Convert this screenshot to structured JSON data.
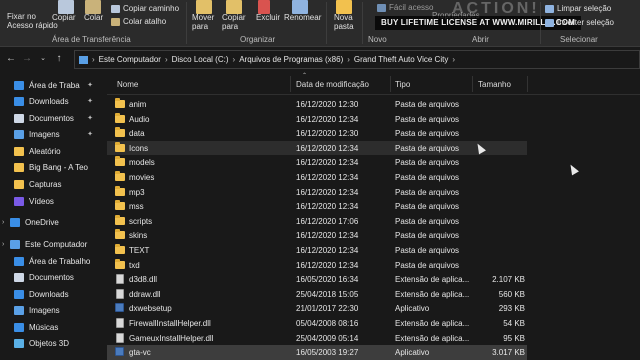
{
  "ribbon": {
    "clipboard": {
      "pin_label": "Fixar no",
      "pin_label2": "Acesso rápido",
      "copy_label": "Copiar",
      "paste_label": "Colar",
      "copy_path_label": "Copiar caminho",
      "paste_shortcut_label": "Colar atalho",
      "group_label": "Área de Transferência"
    },
    "organize": {
      "move_label": "Mover",
      "move_label2": "para",
      "copy_to_label": "Copiar",
      "copy_to_label2": "para",
      "delete_label": "Excluir",
      "rename_label": "Renomear",
      "group_label": "Organizar"
    },
    "new": {
      "new_folder_label": "Nova",
      "new_folder_label2": "pasta",
      "group_label": "Novo"
    },
    "open": {
      "easy_access_label": "Fácil acesso",
      "properties_label": "Propriedades",
      "group_label": "Abrir"
    },
    "select": {
      "clear_selection_label": "Limpar seleção",
      "invert_selection_label": "Inverter seleção",
      "group_label": "Selecionar"
    },
    "watermark_text": "BUY LIFETIME LICENSE AT WWW.MIRILLIS.COM",
    "watermark_logo": "ACTION!"
  },
  "address": {
    "crumbs": [
      "Este Computador",
      "Disco Local (C:)",
      "Arquivos de Programas (x86)",
      "Grand Theft Auto Vice City"
    ]
  },
  "navpane": {
    "items": [
      {
        "label": "Área de Traba",
        "icon": "desktop-icon",
        "color": "#3a8ee6",
        "pinned": true
      },
      {
        "label": "Downloads",
        "icon": "download-icon",
        "color": "#3a8ee6",
        "pinned": true
      },
      {
        "label": "Documentos",
        "icon": "document-icon",
        "color": "#cfd8e6",
        "pinned": true
      },
      {
        "label": "Imagens",
        "icon": "image-icon",
        "color": "#5aa0e6",
        "pinned": true
      },
      {
        "label": "Aleatório",
        "icon": "folder-icon",
        "color": "#f2c14e",
        "pinned": false
      },
      {
        "label": "Big Bang - A Teo",
        "icon": "folder-icon",
        "color": "#f2c14e",
        "pinned": false
      },
      {
        "label": "Capturas",
        "icon": "folder-icon",
        "color": "#f2c14e",
        "pinned": false
      },
      {
        "label": "Vídeos",
        "icon": "video-icon",
        "color": "#7a5ae6",
        "pinned": false
      },
      {
        "label": "OneDrive",
        "icon": "cloud-icon",
        "color": "#3a8ee6",
        "pinned": false
      },
      {
        "label": "Este Computador",
        "icon": "computer-icon",
        "color": "#5aa0e6",
        "pinned": false
      },
      {
        "label": "Área de Trabalho",
        "icon": "desktop-icon",
        "color": "#3a8ee6",
        "pinned": false
      },
      {
        "label": "Documentos",
        "icon": "document-icon",
        "color": "#cfd8e6",
        "pinned": false
      },
      {
        "label": "Downloads",
        "icon": "download-icon",
        "color": "#3a8ee6",
        "pinned": false
      },
      {
        "label": "Imagens",
        "icon": "image-icon",
        "color": "#5aa0e6",
        "pinned": false
      },
      {
        "label": "Músicas",
        "icon": "music-icon",
        "color": "#3a8ee6",
        "pinned": false
      },
      {
        "label": "Objetos 3D",
        "icon": "cube-icon",
        "color": "#5ab0e6",
        "pinned": false
      }
    ]
  },
  "columns": {
    "name": "Nome",
    "date": "Data de modificação",
    "type": "Tipo",
    "size": "Tamanho"
  },
  "files": [
    {
      "name": "anim",
      "date": "16/12/2020 12:30",
      "type": "Pasta de arquivos",
      "size": "",
      "kind": "folder"
    },
    {
      "name": "Audio",
      "date": "16/12/2020 12:34",
      "type": "Pasta de arquivos",
      "size": "",
      "kind": "folder"
    },
    {
      "name": "data",
      "date": "16/12/2020 12:30",
      "type": "Pasta de arquivos",
      "size": "",
      "kind": "folder"
    },
    {
      "name": "Icons",
      "date": "16/12/2020 12:34",
      "type": "Pasta de arquivos",
      "size": "",
      "kind": "folder"
    },
    {
      "name": "models",
      "date": "16/12/2020 12:34",
      "type": "Pasta de arquivos",
      "size": "",
      "kind": "folder"
    },
    {
      "name": "movies",
      "date": "16/12/2020 12:34",
      "type": "Pasta de arquivos",
      "size": "",
      "kind": "folder"
    },
    {
      "name": "mp3",
      "date": "16/12/2020 12:34",
      "type": "Pasta de arquivos",
      "size": "",
      "kind": "folder"
    },
    {
      "name": "mss",
      "date": "16/12/2020 12:34",
      "type": "Pasta de arquivos",
      "size": "",
      "kind": "folder"
    },
    {
      "name": "scripts",
      "date": "16/12/2020 17:06",
      "type": "Pasta de arquivos",
      "size": "",
      "kind": "folder"
    },
    {
      "name": "skins",
      "date": "16/12/2020 12:34",
      "type": "Pasta de arquivos",
      "size": "",
      "kind": "folder"
    },
    {
      "name": "TEXT",
      "date": "16/12/2020 12:34",
      "type": "Pasta de arquivos",
      "size": "",
      "kind": "folder"
    },
    {
      "name": "txd",
      "date": "16/12/2020 12:34",
      "type": "Pasta de arquivos",
      "size": "",
      "kind": "folder"
    },
    {
      "name": "d3d8.dll",
      "date": "16/05/2020 16:34",
      "type": "Extensão de aplica...",
      "size": "2.107 KB",
      "kind": "dll"
    },
    {
      "name": "ddraw.dll",
      "date": "25/04/2018 15:05",
      "type": "Extensão de aplica...",
      "size": "560 KB",
      "kind": "dll"
    },
    {
      "name": "dxwebsetup",
      "date": "21/01/2017 22:30",
      "type": "Aplicativo",
      "size": "293 KB",
      "kind": "exe"
    },
    {
      "name": "FirewallInstallHelper.dll",
      "date": "05/04/2008 08:16",
      "type": "Extensão de aplica...",
      "size": "54 KB",
      "kind": "dll"
    },
    {
      "name": "GameuxInstallHelper.dll",
      "date": "25/04/2009 05:14",
      "type": "Extensão de aplica...",
      "size": "95 KB",
      "kind": "dll"
    },
    {
      "name": "gta-vc",
      "date": "16/05/2003 19:27",
      "type": "Aplicativo",
      "size": "3.017 KB",
      "kind": "exe"
    }
  ],
  "selected_index": 17,
  "hover_index": 3
}
